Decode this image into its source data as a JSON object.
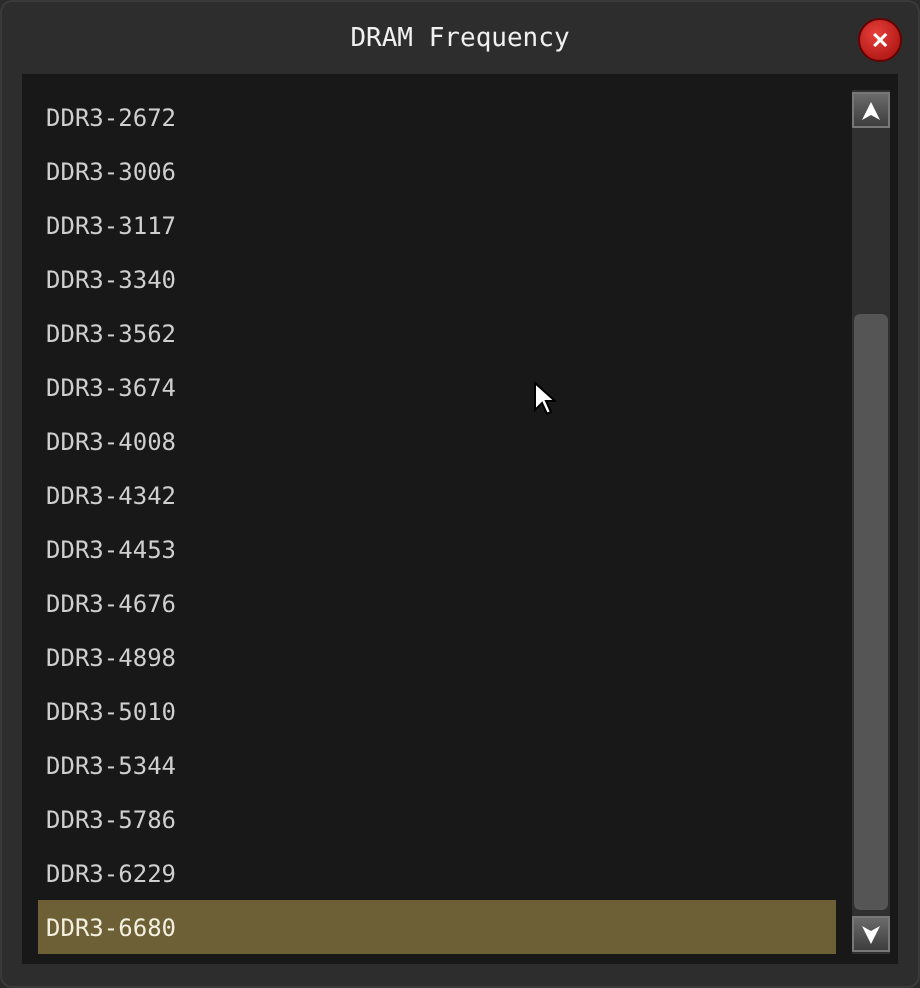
{
  "window": {
    "title": "DRAM Frequency",
    "close": "✕"
  },
  "options": [
    {
      "label": "DDR3-2672",
      "selected": false
    },
    {
      "label": "DDR3-3006",
      "selected": false
    },
    {
      "label": "DDR3-3117",
      "selected": false
    },
    {
      "label": "DDR3-3340",
      "selected": false
    },
    {
      "label": "DDR3-3562",
      "selected": false
    },
    {
      "label": "DDR3-3674",
      "selected": false
    },
    {
      "label": "DDR3-4008",
      "selected": false
    },
    {
      "label": "DDR3-4342",
      "selected": false
    },
    {
      "label": "DDR3-4453",
      "selected": false
    },
    {
      "label": "DDR3-4676",
      "selected": false
    },
    {
      "label": "DDR3-4898",
      "selected": false
    },
    {
      "label": "DDR3-5010",
      "selected": false
    },
    {
      "label": "DDR3-5344",
      "selected": false
    },
    {
      "label": "DDR3-5786",
      "selected": false
    },
    {
      "label": "DDR3-6229",
      "selected": false
    },
    {
      "label": "DDR3-6680",
      "selected": true
    }
  ]
}
